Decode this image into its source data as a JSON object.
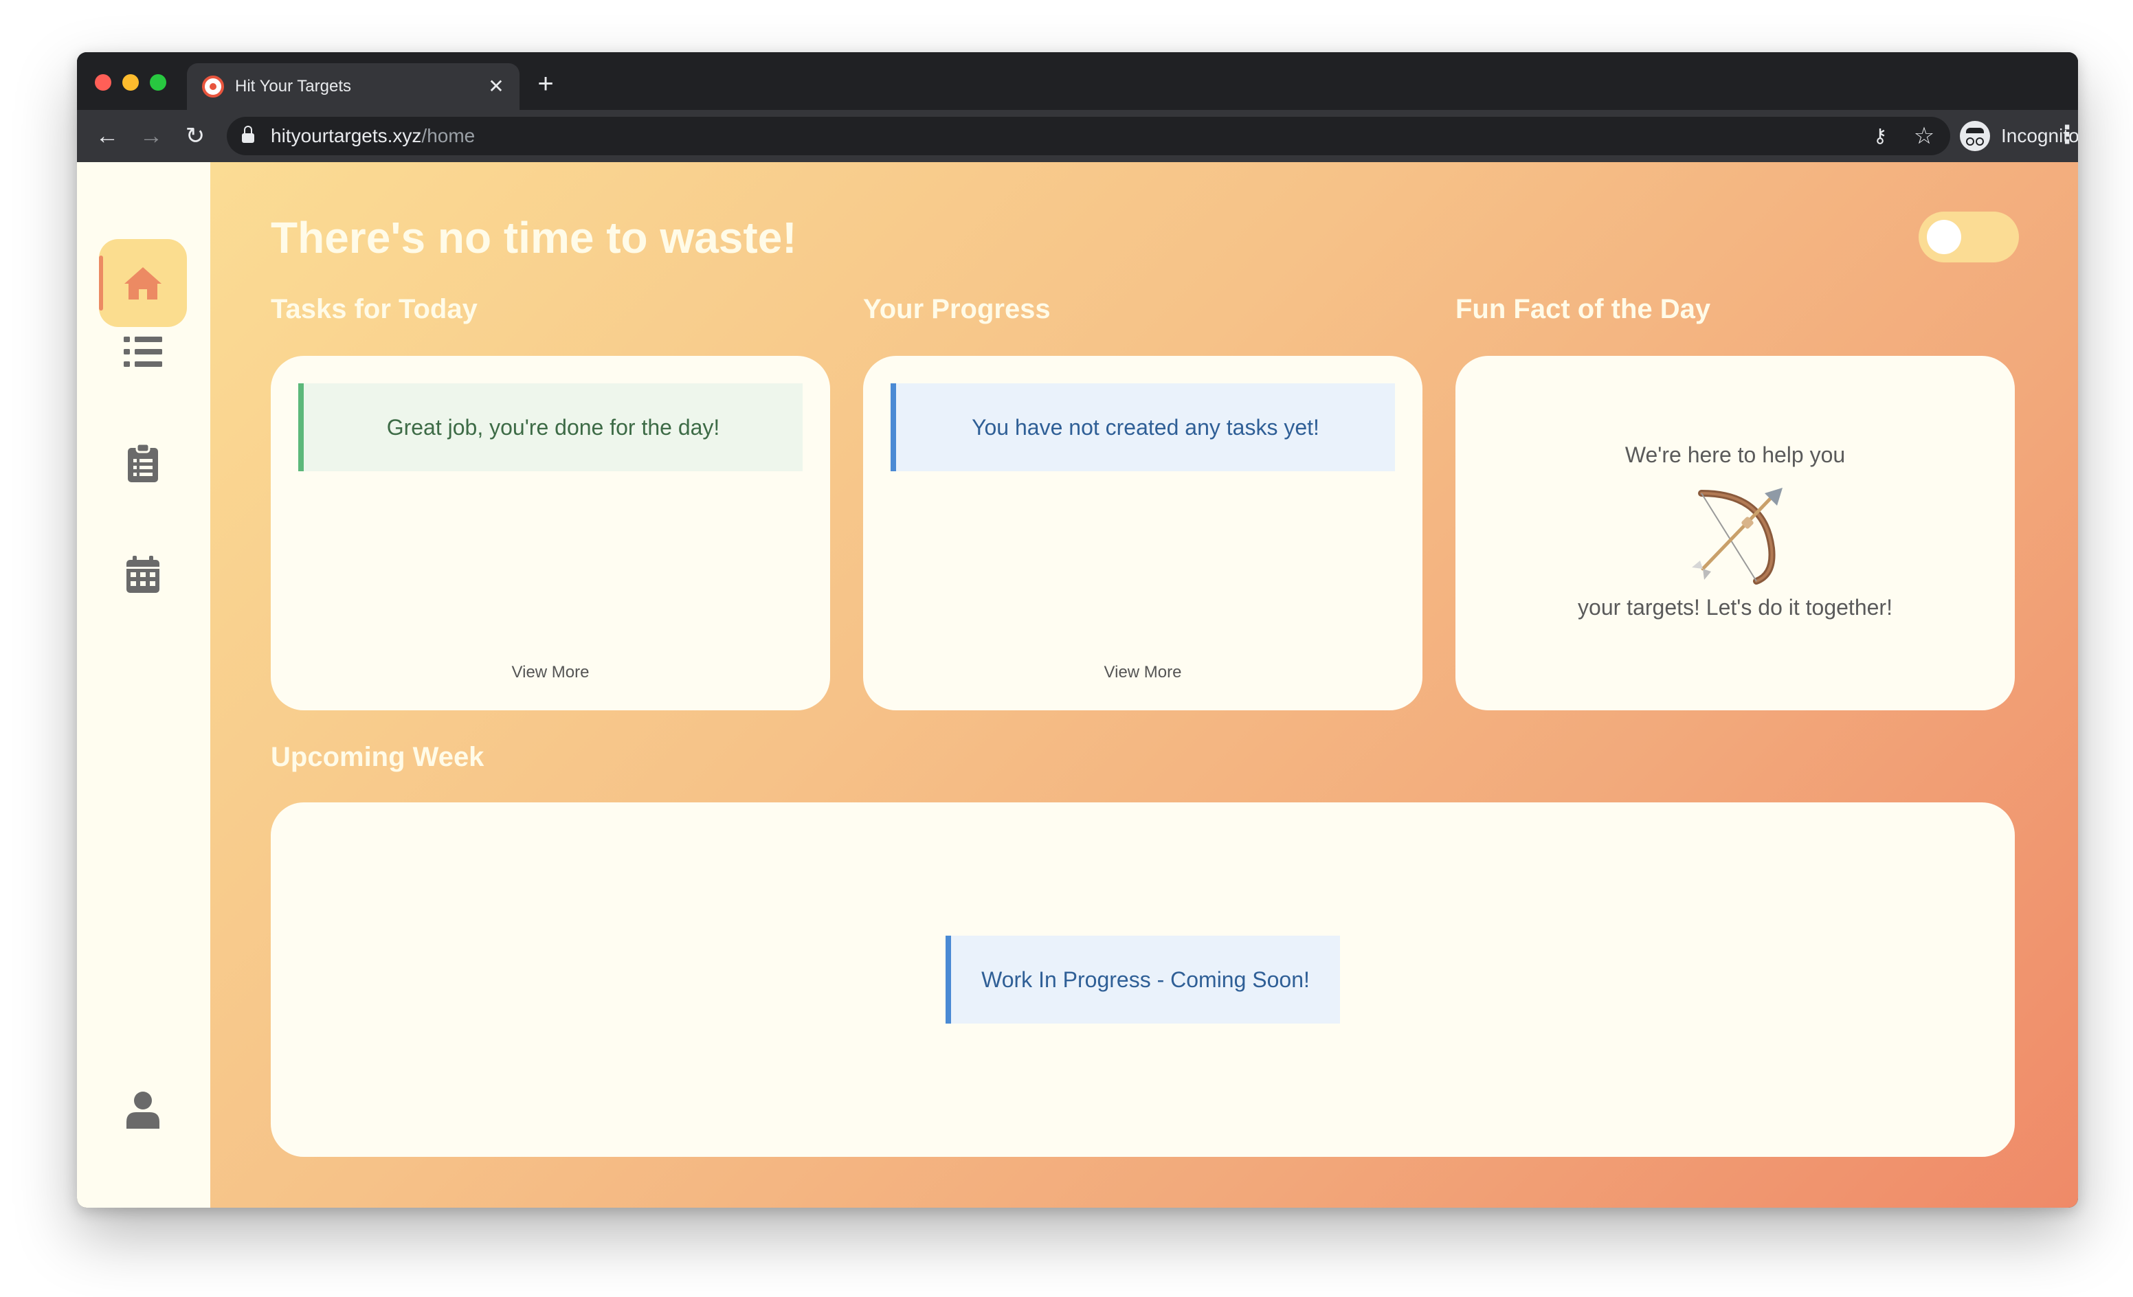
{
  "browser": {
    "tab_title": "Hit Your Targets",
    "tab_close": "✕",
    "new_tab": "+",
    "url_host": "hityourtargets.xyz",
    "url_path": "/home",
    "profile_label": "Incognito",
    "icons": [
      "back-arrow-icon",
      "forward-arrow-icon",
      "reload-icon",
      "lock-icon",
      "key-icon",
      "star-icon",
      "incognito-icon",
      "more-menu-icon"
    ]
  },
  "sidebar": {
    "items": [
      {
        "icon": "home-icon",
        "active": true
      },
      {
        "icon": "list-icon",
        "active": false
      },
      {
        "icon": "clipboard-icon",
        "active": false
      },
      {
        "icon": "calendar-icon",
        "active": false
      }
    ],
    "profile_icon": "user-icon"
  },
  "main": {
    "headline": "There's no time to waste!",
    "theme_toggle_on": false,
    "tasks": {
      "title": "Tasks for Today",
      "message": "Great job, you're done for the day!",
      "view_more": "View More"
    },
    "progress": {
      "title": "Your Progress",
      "message": "You have not created any tasks yet!",
      "view_more": "View More"
    },
    "fun_fact": {
      "title": "Fun Fact of the Day",
      "line1": "We're here to help you",
      "line2": "your targets! Let's do it together!",
      "emoji": "bow-and-arrow"
    },
    "upcoming": {
      "title": "Upcoming Week",
      "message": "Work In Progress - Coming Soon!"
    }
  },
  "colors": {
    "accent": "#ec8a63",
    "active_bg": "#fbdd8f",
    "success_border": "#5cb87a",
    "info_border": "#4a8ad4",
    "card_bg": "#fffdf2",
    "sidebar_bg": "#fffdf0",
    "icon_gray": "#6a6a6a"
  }
}
